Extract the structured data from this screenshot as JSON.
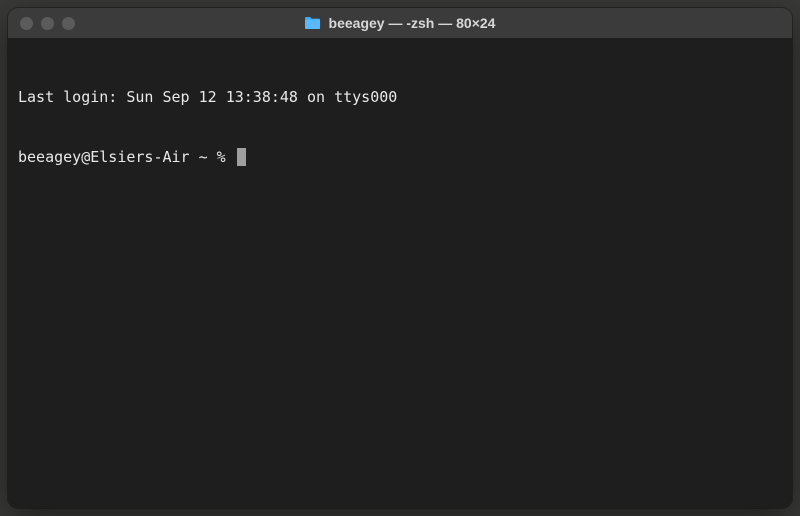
{
  "window": {
    "title": "beeagey — -zsh — 80×24",
    "icon": "folder-icon"
  },
  "terminal": {
    "last_login_line": "Last login: Sun Sep 12 13:38:48 on ttys000",
    "prompt": "beeagey@Elsiers-Air ~ % "
  },
  "colors": {
    "titlebar_bg": "#3b3b3b",
    "terminal_bg": "#1e1e1e",
    "text": "#e8e8e8",
    "cursor": "#9f9f9f",
    "folder_icon": "#3fa9f5"
  }
}
